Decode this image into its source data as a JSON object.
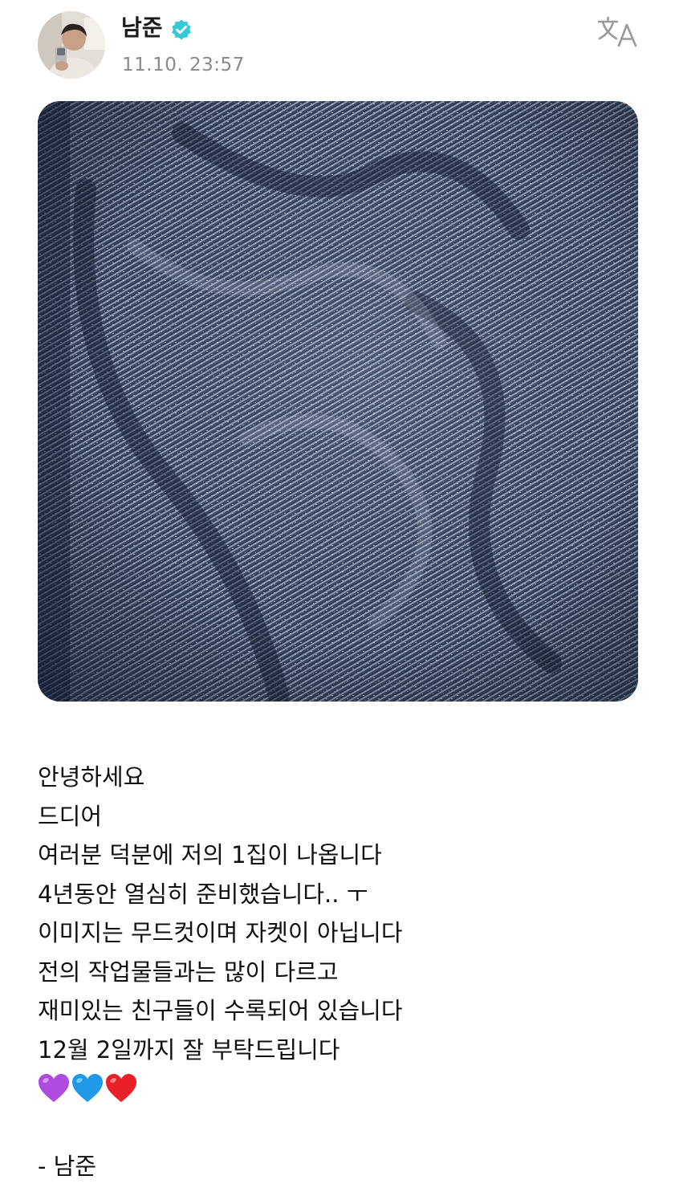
{
  "header": {
    "author_name": "남준",
    "timestamp": "11.10. 23:57",
    "verified_icon": "verified-check-badge",
    "translate_icon": "translate-icon"
  },
  "post": {
    "image_description_icon": "denim-fabric-photo",
    "lines": [
      "안녕하세요",
      "드디어",
      "여러분 덕분에 저의 1집이 나옵니다",
      "4년동안 열심히 준비했습니다.. ㅜ",
      "이미지는 무드컷이며 자켓이 아닙니다",
      "전의 작업물들과는 많이 다르고",
      "재미있는 친구들이 수록되어 있습니다",
      "12월 2일까지 잘 부탁드립니다"
    ],
    "hearts": [
      "purple-heart",
      "blue-heart",
      "red-heart"
    ],
    "signature": "- 남준"
  },
  "colors": {
    "badge": "#36c9d6",
    "timestamp": "#8a8a8a",
    "denim": "#2f3f5c",
    "purple_heart": "#b04be0",
    "blue_heart": "#1e9ae8",
    "red_heart": "#e8202a"
  }
}
